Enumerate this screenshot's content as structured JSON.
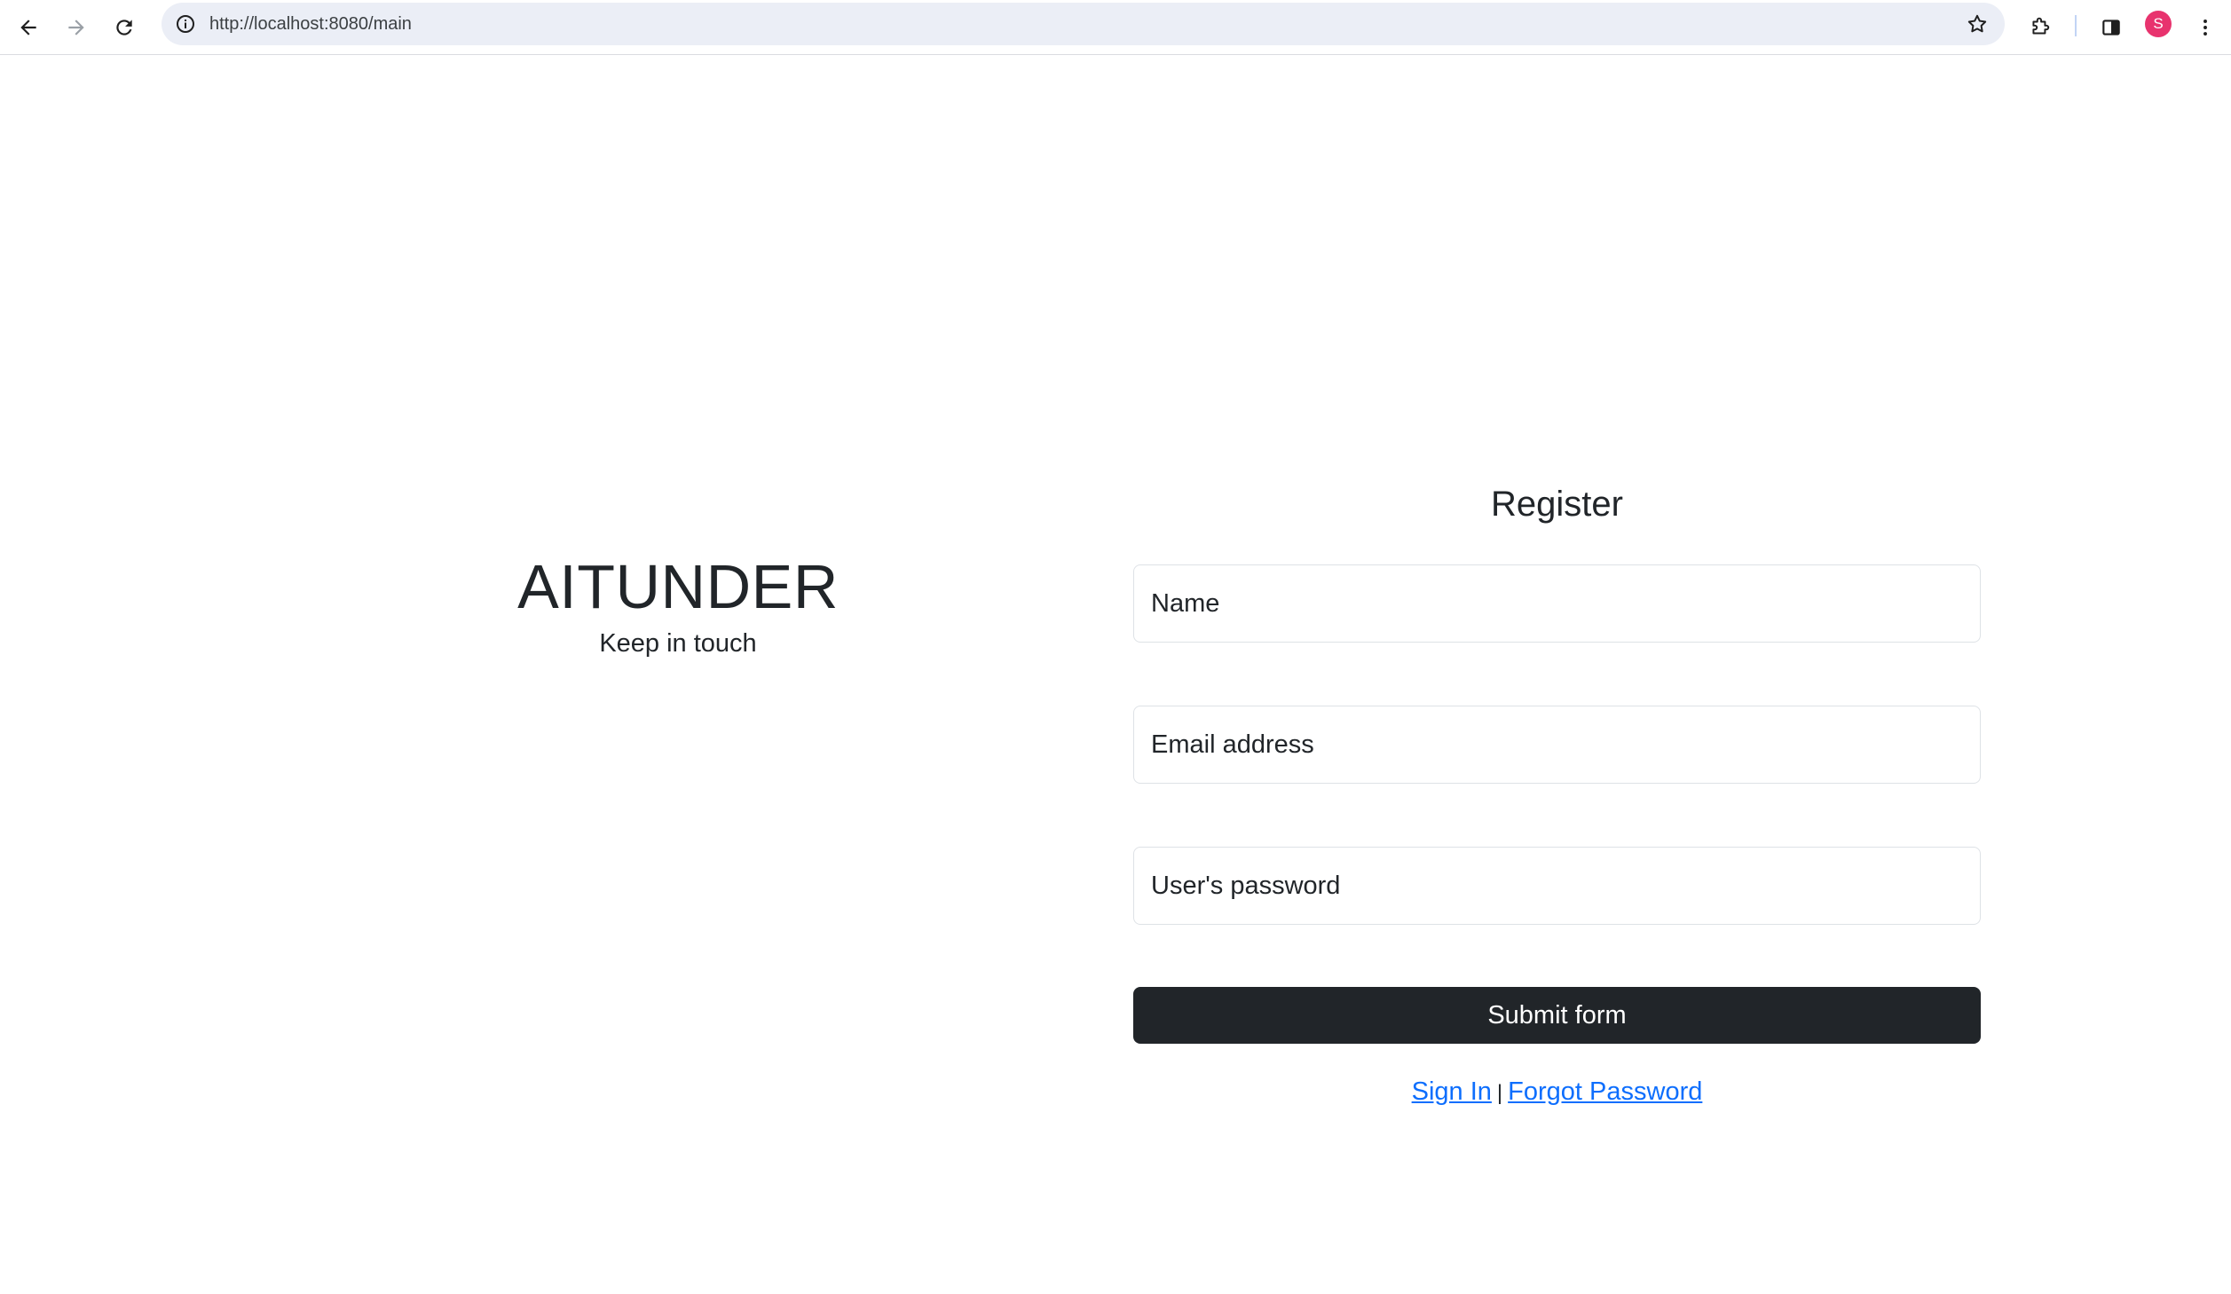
{
  "browser": {
    "url": "http://localhost:8080/main",
    "profile_initial": "S",
    "colors": {
      "omnibox_bg": "#ebeef6",
      "avatar": "#e8336e"
    },
    "icons": [
      "back-arrow-icon",
      "forward-arrow-icon",
      "reload-icon",
      "site-info-icon",
      "bookmark-star-icon",
      "extensions-icon",
      "side-panel-icon",
      "more-vert-icon"
    ]
  },
  "brand": {
    "title": "AITUNDER",
    "tagline": "Keep in touch"
  },
  "register": {
    "title": "Register",
    "name_placeholder": "Name",
    "email_placeholder": "Email address",
    "password_placeholder": "User's password",
    "submit_label": "Submit form",
    "sign_in_label": "Sign In",
    "separator": "|",
    "forgot_password_label": "Forgot Password"
  },
  "colors": {
    "text": "#212529",
    "button_bg": "#212529",
    "link": "#0d6efd",
    "input_border": "#dee2e6"
  }
}
